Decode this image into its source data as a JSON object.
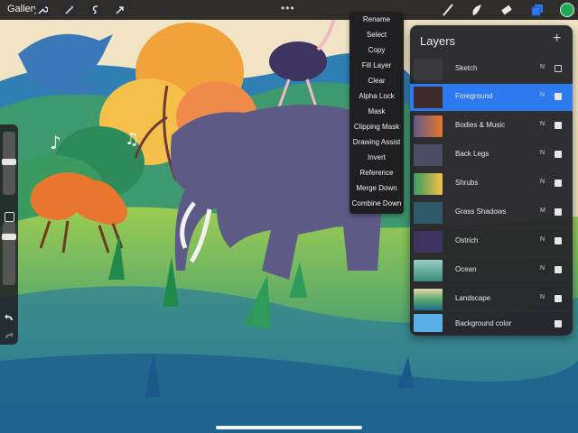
{
  "app": {
    "gallery_label": "Gallery",
    "more_icon": "ellipsis-icon"
  },
  "toolbar_left_icons": [
    "wrench-icon",
    "magic-wand-icon",
    "selection-icon",
    "transform-arrow-icon"
  ],
  "toolbar_right_icons": [
    "brush-icon",
    "smudge-icon",
    "eraser-icon",
    "layers-icon"
  ],
  "color": {
    "current_color": "#1faa55"
  },
  "menu": {
    "items": [
      "Rename",
      "Select",
      "Copy",
      "Fill Layer",
      "Clear",
      "Alpha Lock",
      "Mask",
      "Clipping Mask",
      "Drawing Assist",
      "Invert",
      "Reference",
      "Merge Down",
      "Combine Down"
    ]
  },
  "layers_panel": {
    "title": "Layers",
    "add_icon": "plus-icon",
    "layers": [
      {
        "name": "Sketch",
        "mode": "N",
        "visible": false,
        "selected": false
      },
      {
        "name": "Foreground",
        "mode": "N",
        "visible": true,
        "selected": true
      },
      {
        "name": "Bodies & Music",
        "mode": "N",
        "visible": true,
        "selected": false
      },
      {
        "name": "Back Legs",
        "mode": "N",
        "visible": true,
        "selected": false
      },
      {
        "name": "Shrubs",
        "mode": "N",
        "visible": true,
        "selected": false
      },
      {
        "name": "Grass Shadows",
        "mode": "M",
        "visible": true,
        "selected": false
      },
      {
        "name": "Ostrich",
        "mode": "N",
        "visible": true,
        "selected": false
      },
      {
        "name": "Ocean",
        "mode": "N",
        "visible": true,
        "selected": false
      },
      {
        "name": "Landscape",
        "mode": "N",
        "visible": true,
        "selected": false
      },
      {
        "name": "Background color",
        "mode": "",
        "visible": true,
        "selected": false
      }
    ]
  },
  "sidebar": {
    "brush_size_icon": "brush-size-slider",
    "opacity_icon": "opacity-slider",
    "modify_icon": "square-button-icon",
    "undo_icon": "undo-icon",
    "redo_icon": "redo-icon"
  }
}
